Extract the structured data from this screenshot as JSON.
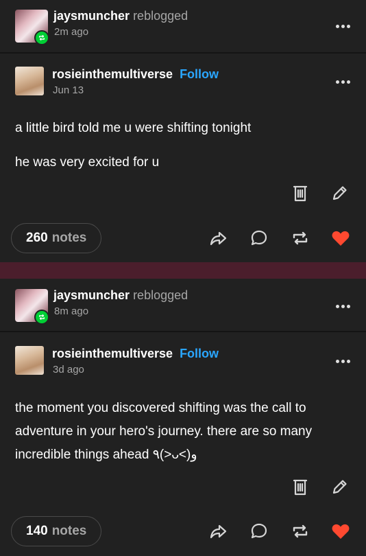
{
  "posts": [
    {
      "reblogger": {
        "name": "jaysmuncher",
        "action": "reblogged",
        "time": "2m ago"
      },
      "author": {
        "name": "rosieinthemultiverse",
        "follow_label": "Follow",
        "date": "Jun 13"
      },
      "body": [
        "a little bird told me u were shifting tonight",
        "he was very excited for u"
      ],
      "notes": {
        "count": "260",
        "label": "notes"
      },
      "liked": true
    },
    {
      "reblogger": {
        "name": "jaysmuncher",
        "action": "reblogged",
        "time": "8m ago"
      },
      "author": {
        "name": "rosieinthemultiverse",
        "follow_label": "Follow",
        "date": "3d ago"
      },
      "body": [
        "the moment you discovered shifting was the call to adventure in your hero's journey. there are so many incredible things ahead ٩(>ᴗ<)و"
      ],
      "notes": {
        "count": "140",
        "label": "notes"
      },
      "liked": true
    }
  ],
  "icons": {
    "menu": "more-horizontal-icon",
    "delete": "trash-icon",
    "edit": "pencil-icon",
    "share": "share-icon",
    "reply": "reply-icon",
    "reblog": "reblog-icon",
    "like": "heart-icon",
    "badge": "reblog-badge-icon"
  },
  "colors": {
    "background": "#212121",
    "separator": "#4b1e2c",
    "follow_link": "#2aa6ff",
    "heart": "#ff4930",
    "reblog_badge": "#00cf35",
    "muted_text": "#a6a6a6"
  }
}
